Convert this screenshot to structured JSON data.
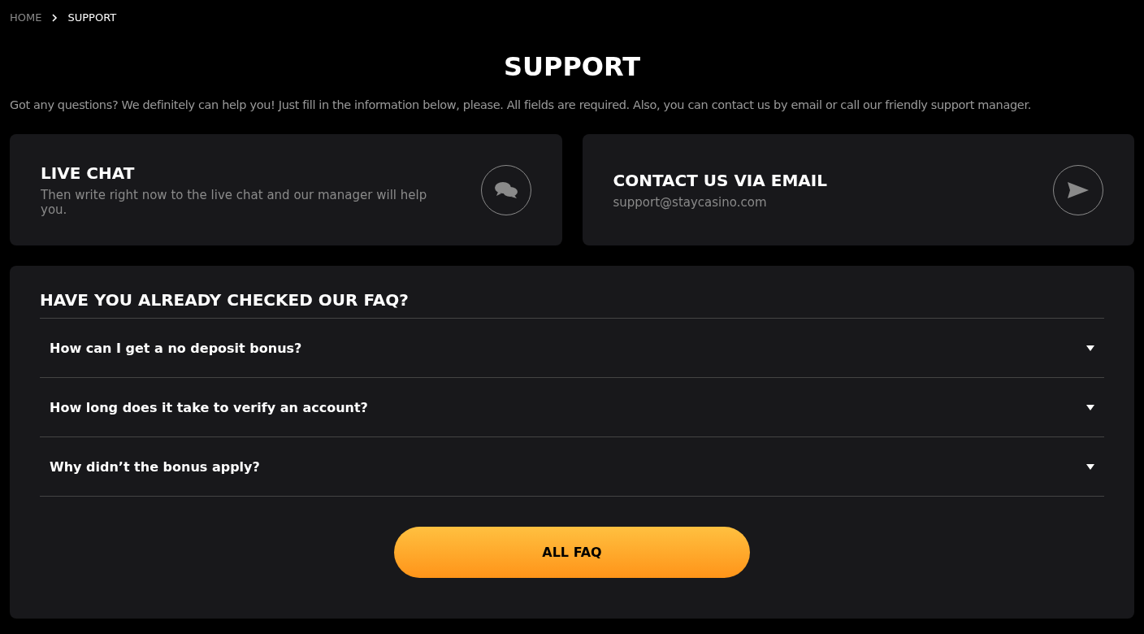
{
  "breadcrumb": [
    {
      "label": "HOME",
      "current": false
    },
    {
      "label": "SUPPORT",
      "current": true
    }
  ],
  "title": "SUPPORT",
  "intro": "Got any questions? We definitely can help you! Just fill in the information below, please. All fields are required. Also, you can contact us by email or call our friendly support manager.",
  "cards": [
    {
      "kind": "chat",
      "title": "LIVE CHAT",
      "text": "Then write right now to the live chat and our manager will help you."
    },
    {
      "kind": "email",
      "title": "CONTACT US VIA EMAIL",
      "text": "support@staycasino.com"
    }
  ],
  "faq": {
    "title": "HAVE YOU ALREADY CHECKED OUR FAQ?",
    "items": [
      {
        "question": "How can I get a no deposit bonus?",
        "expanded": false
      },
      {
        "question": "How long does it take to verify an account?",
        "expanded": false
      },
      {
        "question": "Why didn’t the bonus apply?",
        "expanded": false
      }
    ],
    "button": "ALL FAQ"
  }
}
